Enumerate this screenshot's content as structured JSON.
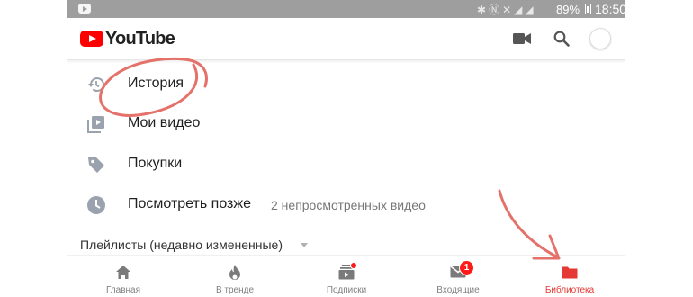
{
  "status_bar": {
    "battery": "89%",
    "time": "18:50",
    "icons": [
      "bluetooth-icon",
      "nfc-icon",
      "mute-icon",
      "signal-icon",
      "signal-icon",
      "battery-icon"
    ]
  },
  "header": {
    "logo_text": "YouTube",
    "actions": [
      "camera-icon",
      "search-icon",
      "avatar"
    ]
  },
  "library": {
    "items": [
      {
        "label": "История",
        "icon": "history-icon"
      },
      {
        "label": "Мои видео",
        "icon": "my-videos-icon"
      },
      {
        "label": "Покупки",
        "icon": "tag-icon"
      },
      {
        "label": "Посмотреть позже",
        "icon": "clock-icon",
        "sublabel": "2 непросмотренных видео"
      }
    ],
    "playlists_header": "Плейлисты (недавно измененные)"
  },
  "bottom_nav": {
    "tabs": [
      {
        "label": "Главная",
        "icon": "home-icon"
      },
      {
        "label": "В тренде",
        "icon": "fire-icon"
      },
      {
        "label": "Подписки",
        "icon": "subscriptions-icon",
        "badge": "dot"
      },
      {
        "label": "Входящие",
        "icon": "inbox-icon",
        "badge": "1"
      },
      {
        "label": "Библиотека",
        "icon": "folder-icon",
        "active": true
      }
    ]
  },
  "colors": {
    "brand_red": "#ff0000",
    "active_tab": "#e53935",
    "annotation": "#e4726a",
    "status_bar": "#9e9e9e"
  }
}
